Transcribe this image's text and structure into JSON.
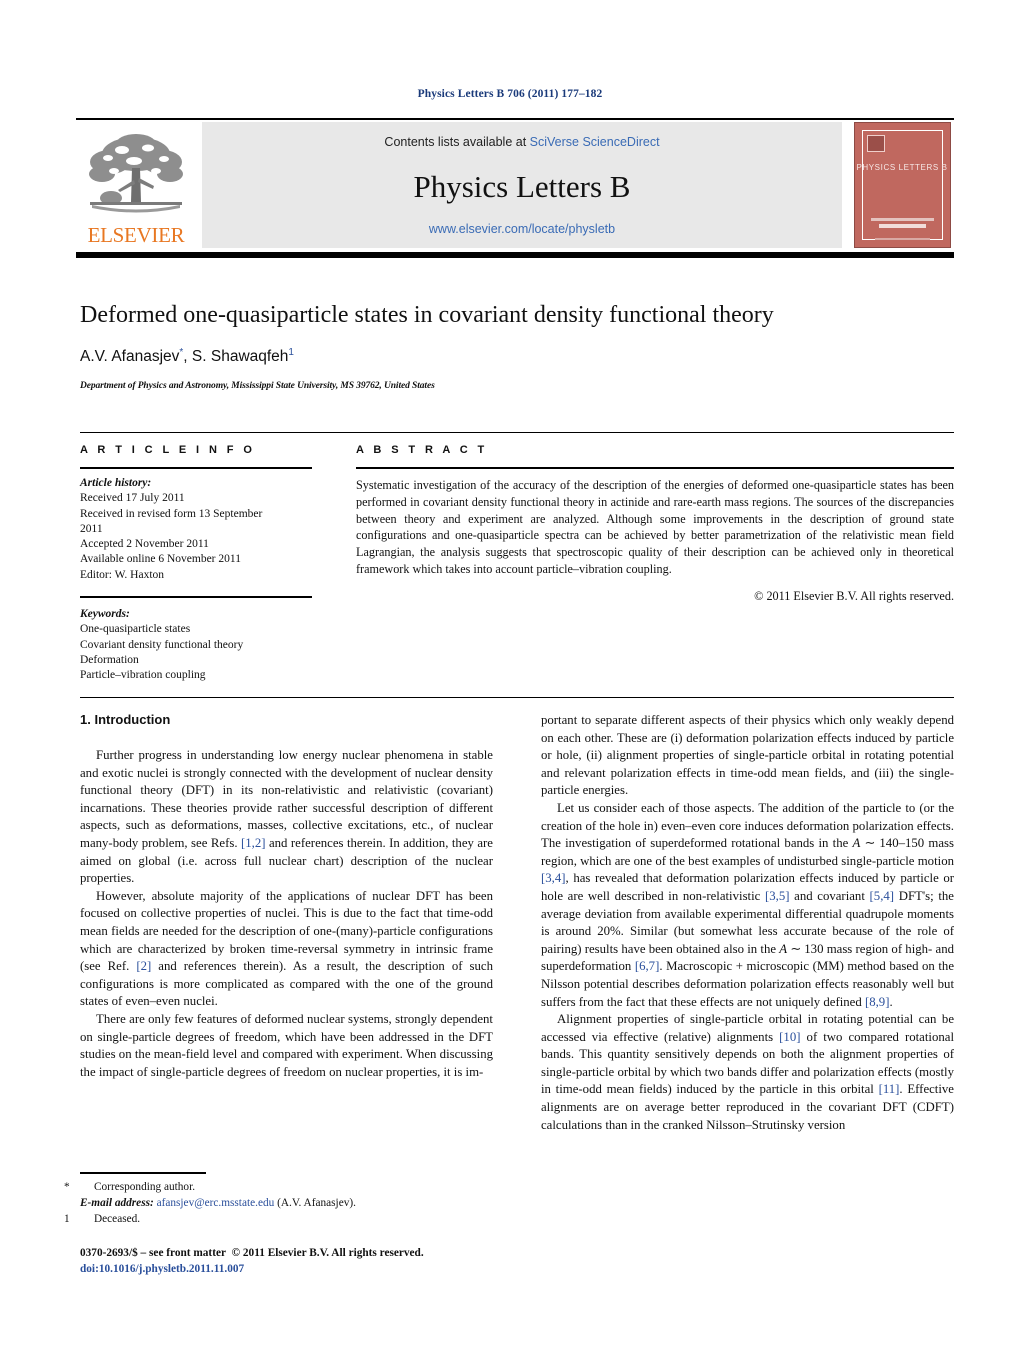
{
  "running_head": "Physics Letters B 706 (2011) 177–182",
  "masthead": {
    "contents_prefix": "Contents lists available at ",
    "contents_link": "SciVerse ScienceDirect",
    "journal_name": "Physics Letters B",
    "journal_url": "www.elsevier.com/locate/physletb",
    "publisher_wordmark": "ELSEVIER",
    "cover_title": "PHYSICS LETTERS B"
  },
  "article": {
    "title": "Deformed one-quasiparticle states in covariant density functional theory",
    "authors": "A.V. Afanasjev",
    "author_mark_1": "*",
    "authors_2": ", S. Shawaqfeh",
    "author_mark_2": "1",
    "affiliation": "Department of Physics and Astronomy, Mississippi State University, MS 39762, United States"
  },
  "info": {
    "heading": "A R T I C L E   I N F O",
    "history_label": "Article history:",
    "history": [
      "Received 17 July 2011",
      "Received in revised form 13 September",
      "2011",
      "Accepted 2 November 2011",
      "Available online 6 November 2011",
      "Editor: W. Haxton"
    ],
    "keywords_label": "Keywords:",
    "keywords": [
      "One-quasiparticle states",
      "Covariant density functional theory",
      "Deformation",
      "Particle–vibration coupling"
    ]
  },
  "abstract": {
    "heading": "A B S T R A C T",
    "text": "Systematic investigation of the accuracy of the description of the energies of deformed one-quasiparticle states has been performed in covariant density functional theory in actinide and rare-earth mass regions. The sources of the discrepancies between theory and experiment are analyzed. Although some improvements in the description of ground state configurations and one-quasiparticle spectra can be achieved by better parametrization of the relativistic mean field Lagrangian, the analysis suggests that spectroscopic quality of their description can be achieved only in theoretical framework which takes into account particle–vibration coupling.",
    "copyright": "© 2011 Elsevier B.V. All rights reserved."
  },
  "section": {
    "heading": "1. Introduction"
  },
  "left_column": {
    "p1_a": "Further progress in understanding low energy nuclear phenomena in stable and exotic nuclei is strongly connected with the development of nuclear density functional theory (DFT) in its non-relativistic and relativistic (covariant) incarnations. These theories provide rather successful description of different aspects, such as deformations, masses, collective excitations, etc., of nuclear many-body problem, see Refs. ",
    "p1_ref": "[1,2]",
    "p1_b": " and references therein. In addition, they are aimed on global (i.e. across full nuclear chart) description of the nuclear properties.",
    "p2_a": "However, absolute majority of the applications of nuclear DFT has been focused on collective properties of nuclei. This is due to the fact that time-odd mean fields are needed for the description of one-(many)-particle configurations which are characterized by broken time-reversal symmetry in intrinsic frame (see Ref. ",
    "p2_ref": "[2]",
    "p2_b": " and references therein). As a result, the description of such configurations is more complicated as compared with the one of the ground states of even–even nuclei.",
    "p3": "There are only few features of deformed nuclear systems, strongly dependent on single-particle degrees of freedom, which have been addressed in the DFT studies on the mean-field level and compared with experiment. When discussing the impact of single-particle degrees of freedom on nuclear properties, it is im-"
  },
  "right_column": {
    "p1": "portant to separate different aspects of their physics which only weakly depend on each other. These are (i) deformation polarization effects induced by particle or hole, (ii) alignment properties of single-particle orbital in rotating potential and relevant polarization effects in time-odd mean fields, and (iii) the single-particle energies.",
    "p2_a": "Let us consider each of those aspects. The addition of the particle to (or the creation of the hole in) even–even core induces deformation polarization effects. The investigation of superdeformed rotational bands in the ",
    "p2_italic_a": "A",
    "p2_b": " ∼ 140–150 mass region, which are one of the best examples of undisturbed single-particle motion ",
    "p2_ref1": "[3,4]",
    "p2_c": ", has revealed that deformation polarization effects induced by particle or hole are well described in non-relativistic ",
    "p2_ref2": "[3,5]",
    "p2_d": " and covariant ",
    "p2_ref3": "[5,4]",
    "p2_e": " DFT's; the average deviation from available experimental differential quadrupole moments is around 20%. Similar (but somewhat less accurate because of the role of pairing) results have been obtained also in the ",
    "p2_italic_b": "A",
    "p2_f": " ∼ 130 mass region of high- and superdeformation ",
    "p2_ref4": "[6,7]",
    "p2_g": ". Macroscopic + microscopic (MM) method based on the Nilsson potential describes deformation polarization effects reasonably well but suffers from the fact that these effects are not uniquely defined ",
    "p2_ref5": "[8,9]",
    "p2_h": ".",
    "p3_a": "Alignment properties of single-particle orbital in rotating potential can be accessed via effective (relative) alignments ",
    "p3_ref1": "[10]",
    "p3_b": " of two compared rotational bands. This quantity sensitively depends on both the alignment properties of single-particle orbital by which two bands differ and polarization effects (mostly in time-odd mean fields) induced by the particle in this orbital ",
    "p3_ref2": "[11]",
    "p3_c": ". Effective alignments are on average better reproduced in the covariant DFT (CDFT) calculations than in the cranked Nilsson–Strutinsky version"
  },
  "footnotes": {
    "corresponding_mark": "*",
    "corresponding_text": "Corresponding author.",
    "email_label": "E-mail address:",
    "email": "afansjev@erc.msstate.edu",
    "email_suffix": " (A.V. Afanasjev).",
    "deceased_mark": "1",
    "deceased_text": "Deceased."
  },
  "imprint": {
    "issn_line": "0370-2693/$ – see front matter",
    "copyright": "© 2011 Elsevier B.V. All rights reserved.",
    "doi": "doi:10.1016/j.physletb.2011.11.007"
  },
  "colors": {
    "link": "#2a4f9b",
    "running_head": "#1a3a7a",
    "elsevier_orange": "#E87722",
    "cover_red": "#c0685f",
    "banner_gray": "#e8e8e8"
  }
}
